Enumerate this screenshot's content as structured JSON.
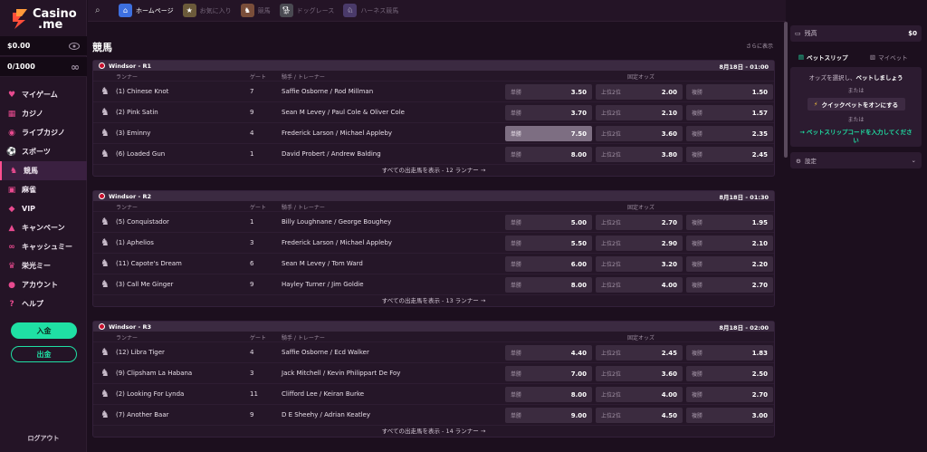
{
  "brand": {
    "line1": "Casino",
    "line2": ".me"
  },
  "balances": [
    {
      "value": "$0.00",
      "icon": "eye-icon"
    },
    {
      "value": "0/1000",
      "icon": "infinity-icon"
    }
  ],
  "nav": [
    {
      "label": "マイゲーム",
      "icon": "heart-icon"
    },
    {
      "label": "カジノ",
      "icon": "cards-icon"
    },
    {
      "label": "ライブカジノ",
      "icon": "live-icon"
    },
    {
      "label": "スポーツ",
      "icon": "ball-icon"
    },
    {
      "label": "競馬",
      "icon": "horse-icon",
      "active": true
    },
    {
      "label": "麻雀",
      "icon": "mahjong-icon"
    },
    {
      "label": "VIP",
      "icon": "diamond-icon"
    },
    {
      "label": "キャンペーン",
      "icon": "bell-icon"
    },
    {
      "label": "キャッシュミー",
      "icon": "infinity-icon"
    },
    {
      "label": "栄光ミー",
      "icon": "trophy-icon"
    },
    {
      "label": "アカウント",
      "icon": "user-icon"
    },
    {
      "label": "ヘルプ",
      "icon": "help-icon"
    }
  ],
  "deposit_label": "入金",
  "withdraw_label": "出金",
  "logout_label": "ログアウト",
  "topbar": [
    {
      "label": "ホームページ",
      "icon": "home-icon",
      "active": true
    },
    {
      "label": "お気に入り",
      "icon": "star-icon"
    },
    {
      "label": "競馬",
      "icon": "horse-icon"
    },
    {
      "label": "ドッグレース",
      "icon": "dog-icon"
    },
    {
      "label": "ハーネス競馬",
      "icon": "harness-icon"
    }
  ],
  "page_title": "競馬",
  "show_more": "さらに表示",
  "columns": {
    "runner": "ランナー",
    "gate": "ゲート",
    "jockey": "騎手 / トレーナー",
    "fixed_odds": "固定オッズ"
  },
  "odds_labels": {
    "win": "単勝",
    "top2": "上位2位",
    "place": "複勝"
  },
  "races": [
    {
      "name": "Windsor - R1",
      "time": "8月18日 - 01:00",
      "footer": "すべての出走馬を表示 - 12 ランナー →",
      "runners": [
        {
          "name": "(1) Chinese Knot",
          "gate": "7",
          "jockey": "Saffie Osborne / Rod Millman",
          "win": "3.50",
          "top2": "2.00",
          "place": "1.50"
        },
        {
          "name": "(2) Pink Satin",
          "gate": "9",
          "jockey": "Sean M Levey / Paul Cole & Oliver Cole",
          "win": "3.70",
          "top2": "2.10",
          "place": "1.57"
        },
        {
          "name": "(3) Eminny",
          "gate": "4",
          "jockey": "Frederick Larson / Michael Appleby",
          "win": "7.50",
          "top2": "3.60",
          "place": "2.35",
          "hl": true
        },
        {
          "name": "(6) Loaded Gun",
          "gate": "1",
          "jockey": "David Probert / Andrew Balding",
          "win": "8.00",
          "top2": "3.80",
          "place": "2.45"
        }
      ]
    },
    {
      "name": "Windsor - R2",
      "time": "8月18日 - 01:30",
      "footer": "すべての出走馬を表示 - 13 ランナー →",
      "runners": [
        {
          "name": "(5) Conquistador",
          "gate": "1",
          "jockey": "Billy Loughnane / George Boughey",
          "win": "5.00",
          "top2": "2.70",
          "place": "1.95"
        },
        {
          "name": "(1) Aphelios",
          "gate": "3",
          "jockey": "Frederick Larson / Michael Appleby",
          "win": "5.50",
          "top2": "2.90",
          "place": "2.10"
        },
        {
          "name": "(11) Capote's Dream",
          "gate": "6",
          "jockey": "Sean M Levey / Tom Ward",
          "win": "6.00",
          "top2": "3.20",
          "place": "2.20"
        },
        {
          "name": "(3) Call Me Ginger",
          "gate": "9",
          "jockey": "Hayley Turner / Jim Goldie",
          "win": "8.00",
          "top2": "4.00",
          "place": "2.70"
        }
      ]
    },
    {
      "name": "Windsor - R3",
      "time": "8月18日 - 02:00",
      "footer": "すべての出走馬を表示 - 14 ランナー →",
      "runners": [
        {
          "name": "(12) Libra Tiger",
          "gate": "4",
          "jockey": "Saffie Osborne / Ecd Walker",
          "win": "4.40",
          "top2": "2.45",
          "place": "1.83"
        },
        {
          "name": "(9) Clipsham La Habana",
          "gate": "3",
          "jockey": "Jack Mitchell / Kevin Philippart De Foy",
          "win": "7.00",
          "top2": "3.60",
          "place": "2.50"
        },
        {
          "name": "(2) Looking For Lynda",
          "gate": "11",
          "jockey": "Clifford Lee / Keiran Burke",
          "win": "8.00",
          "top2": "4.00",
          "place": "2.70"
        },
        {
          "name": "(7) Another Baar",
          "gate": "9",
          "jockey": "D E Sheehy / Adrian Keatley",
          "win": "9.00",
          "top2": "4.50",
          "place": "3.00"
        }
      ]
    }
  ],
  "right": {
    "wallet_label": "残高",
    "wallet_value": "$0",
    "tab_slip": "ベットスリップ",
    "tab_mybets": "マイベット",
    "slip_prompt_a": "オッズを選択し、",
    "slip_prompt_b": "ベットしましょう",
    "or1": "または",
    "quick_bet": "クイックベットをオンにする",
    "or2": "または",
    "code_link": "→ ベットスリップコードを入力してください",
    "settings": "設定"
  }
}
